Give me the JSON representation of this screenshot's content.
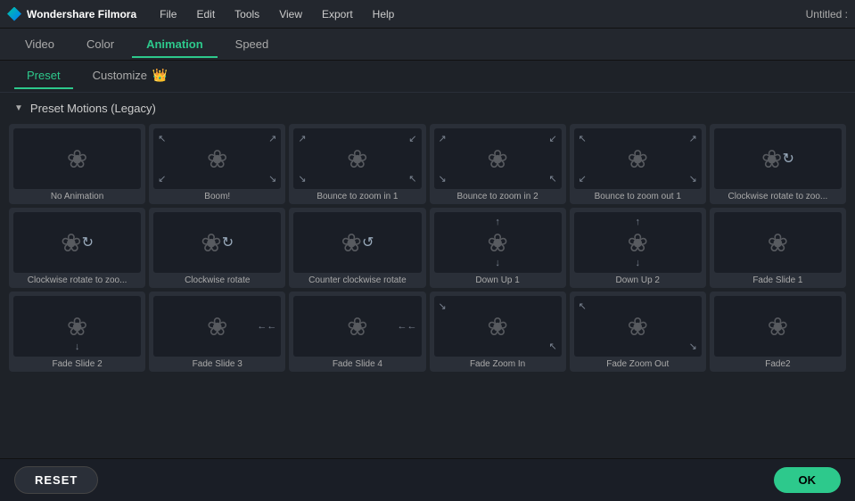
{
  "app": {
    "name": "Wondershare Filmora",
    "title": "Untitled :"
  },
  "menubar": {
    "items": [
      "File",
      "Edit",
      "Tools",
      "View",
      "Export",
      "Help"
    ]
  },
  "tabs": {
    "items": [
      "Video",
      "Color",
      "Animation",
      "Speed"
    ],
    "active": "Animation"
  },
  "subtabs": {
    "items": [
      "Preset",
      "Customize"
    ],
    "active": "Preset"
  },
  "section": {
    "label": "Preset Motions (Legacy)"
  },
  "grid": {
    "items": [
      {
        "label": "No Animation",
        "arrows": "none",
        "rotate": false
      },
      {
        "label": "Boom!",
        "arrows": "outward",
        "rotate": false
      },
      {
        "label": "Bounce to zoom in 1",
        "arrows": "inward-corner",
        "rotate": false
      },
      {
        "label": "Bounce to zoom in 2",
        "arrows": "inward-corner",
        "rotate": false
      },
      {
        "label": "Bounce to zoom out 1",
        "arrows": "outward-corner",
        "rotate": false
      },
      {
        "label": "Clockwise rotate to zoo...",
        "arrows": "rotate-cw",
        "rotate": true
      },
      {
        "label": "Clockwise rotate to zoo...",
        "arrows": "rotate-cw",
        "rotate": true
      },
      {
        "label": "Clockwise rotate",
        "arrows": "rotate-cw",
        "rotate": true
      },
      {
        "label": "Counter clockwise rotate",
        "arrows": "rotate-ccw",
        "rotate": true
      },
      {
        "label": "Down Up 1",
        "arrows": "down-up",
        "rotate": false
      },
      {
        "label": "Down Up 2",
        "arrows": "down-up",
        "rotate": false
      },
      {
        "label": "Fade Slide 1",
        "arrows": "none",
        "rotate": false
      },
      {
        "label": "Fade Slide 2",
        "arrows": "down",
        "rotate": false
      },
      {
        "label": "Fade Slide 3",
        "arrows": "right",
        "rotate": false
      },
      {
        "label": "Fade Slide 4",
        "arrows": "right2",
        "rotate": false
      },
      {
        "label": "Fade Zoom In",
        "arrows": "inward-center",
        "rotate": false
      },
      {
        "label": "Fade Zoom Out",
        "arrows": "outward-center",
        "rotate": false
      },
      {
        "label": "Fade2",
        "arrows": "none",
        "rotate": false
      }
    ]
  },
  "buttons": {
    "reset": "RESET",
    "ok": "OK"
  }
}
